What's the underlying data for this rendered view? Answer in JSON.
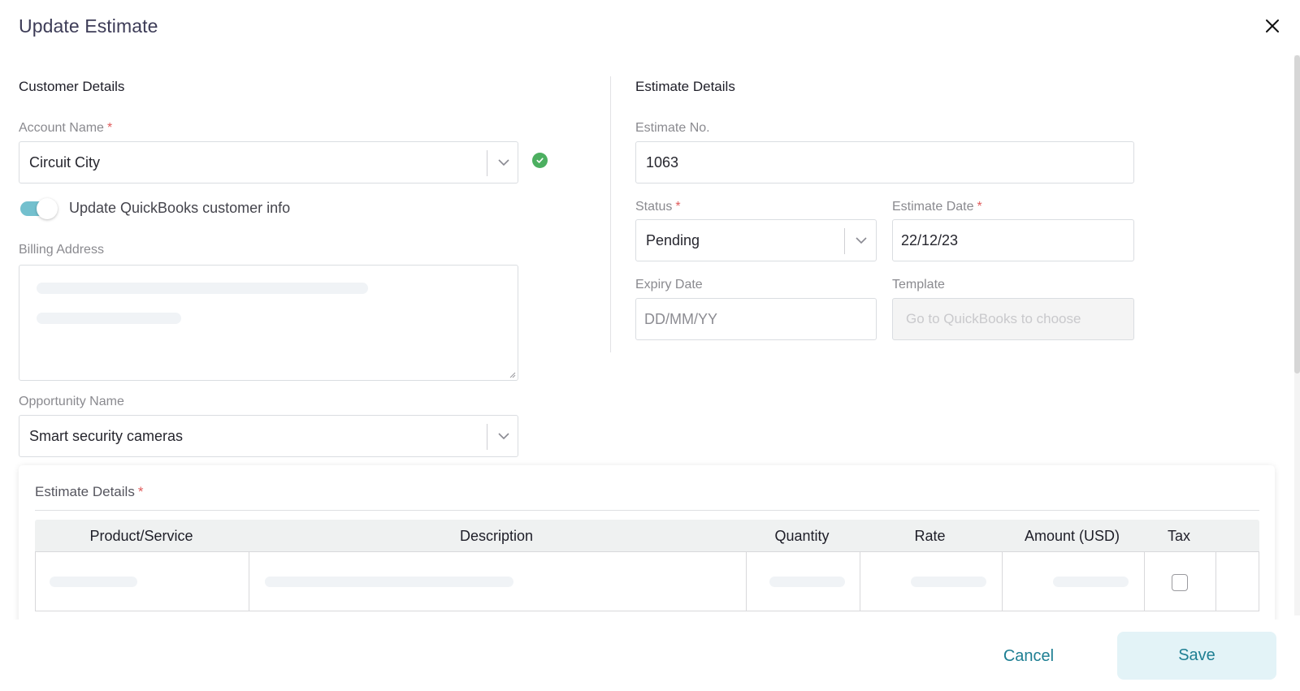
{
  "dialog": {
    "title": "Update Estimate",
    "close_icon": "close-icon"
  },
  "customer": {
    "heading": "Customer Details",
    "account_name": {
      "label": "Account Name",
      "required_mark": "*",
      "value": "Circuit City",
      "verified_icon": "check-circle-icon",
      "verified_color": "#4caf60"
    },
    "update_toggle": {
      "label": "Update QuickBooks customer info",
      "on": true,
      "color": "#73c0ce"
    },
    "billing_address": {
      "label": "Billing Address",
      "value": "",
      "loading": true
    },
    "opportunity_name": {
      "label": "Opportunity Name",
      "value": "Smart security cameras"
    }
  },
  "estimate": {
    "heading": "Estimate Details",
    "estimate_no": {
      "label": "Estimate No.",
      "value": "1063"
    },
    "status": {
      "label": "Status",
      "required_mark": "*",
      "value": "Pending"
    },
    "estimate_date": {
      "label": "Estimate Date",
      "required_mark": "*",
      "value": "22/12/23"
    },
    "expiry_date": {
      "label": "Expiry Date",
      "value": "",
      "placeholder": "DD/MM/YY"
    },
    "template": {
      "label": "Template",
      "value": "",
      "placeholder": "Go to QuickBooks to choose",
      "disabled": true
    }
  },
  "line_items": {
    "title": "Estimate Details",
    "required_mark": "*",
    "columns": [
      "Product/Service",
      "Description",
      "Quantity",
      "Rate",
      "Amount (USD)",
      "Tax"
    ],
    "rows": [
      {
        "product": "",
        "description": "",
        "quantity": "",
        "rate": "",
        "amount": "",
        "tax": false,
        "loading": true
      }
    ]
  },
  "footer": {
    "cancel_label": "Cancel",
    "save_label": "Save",
    "accent_color": "#1e7f93"
  }
}
